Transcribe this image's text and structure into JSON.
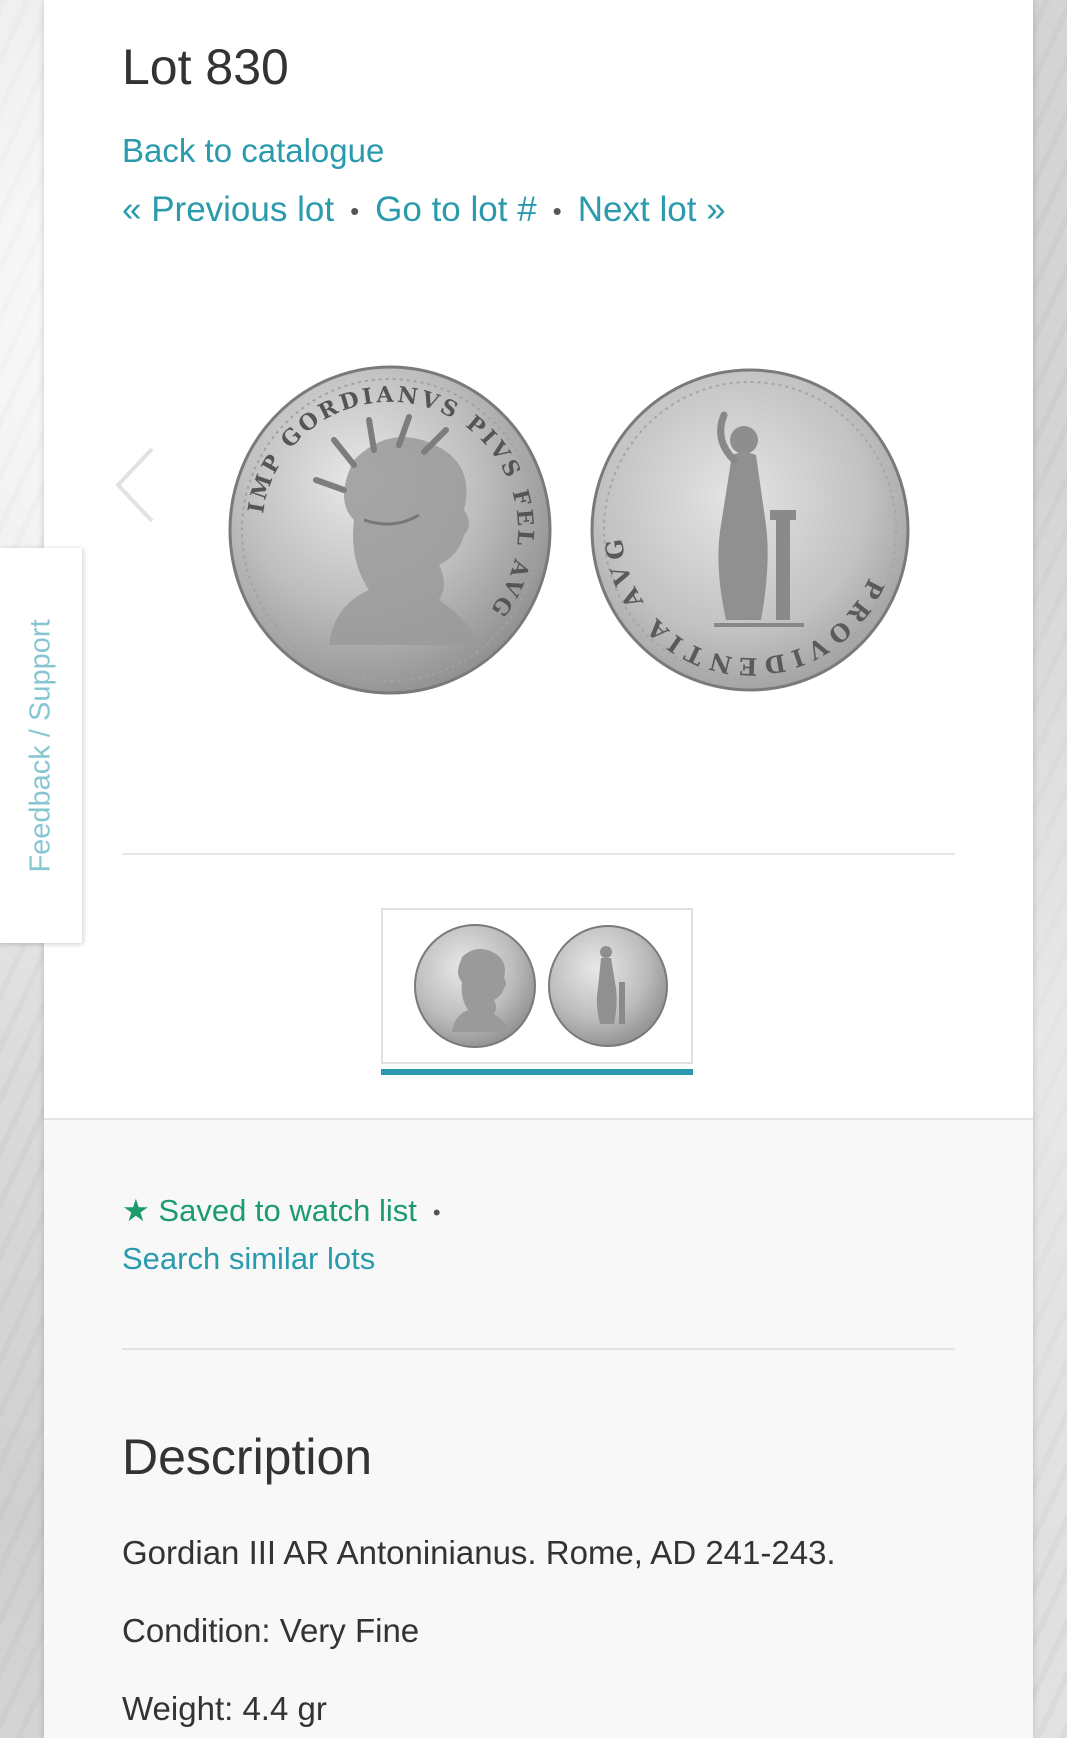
{
  "lot": {
    "title": "Lot 830"
  },
  "nav": {
    "back": "Back to catalogue",
    "previous": "« Previous lot",
    "goto": "Go to lot #",
    "next": "Next lot »",
    "separator": "•"
  },
  "gallery": {
    "prev_icon": "chevron-left-icon",
    "next_icon": "chevron-right-icon",
    "obverse_legend": "IMP GORDIANVS PIVS FEL AVG",
    "reverse_legend": "PROVIDENTIA AVG"
  },
  "actions": {
    "watch": "Saved to watch list",
    "watch_icon": "★",
    "separator": "•",
    "similar": "Search similar lots"
  },
  "description": {
    "title": "Description",
    "lines": [
      "Gordian III AR Antoninianus. Rome, AD 241-243.",
      "Condition: Very Fine",
      "Weight: 4.4 gr"
    ]
  },
  "feedback": {
    "label": "Feedback / Support"
  },
  "colors": {
    "link": "#2a9aad",
    "watch": "#1c9c6c",
    "accent_bar": "#2a9aad"
  }
}
